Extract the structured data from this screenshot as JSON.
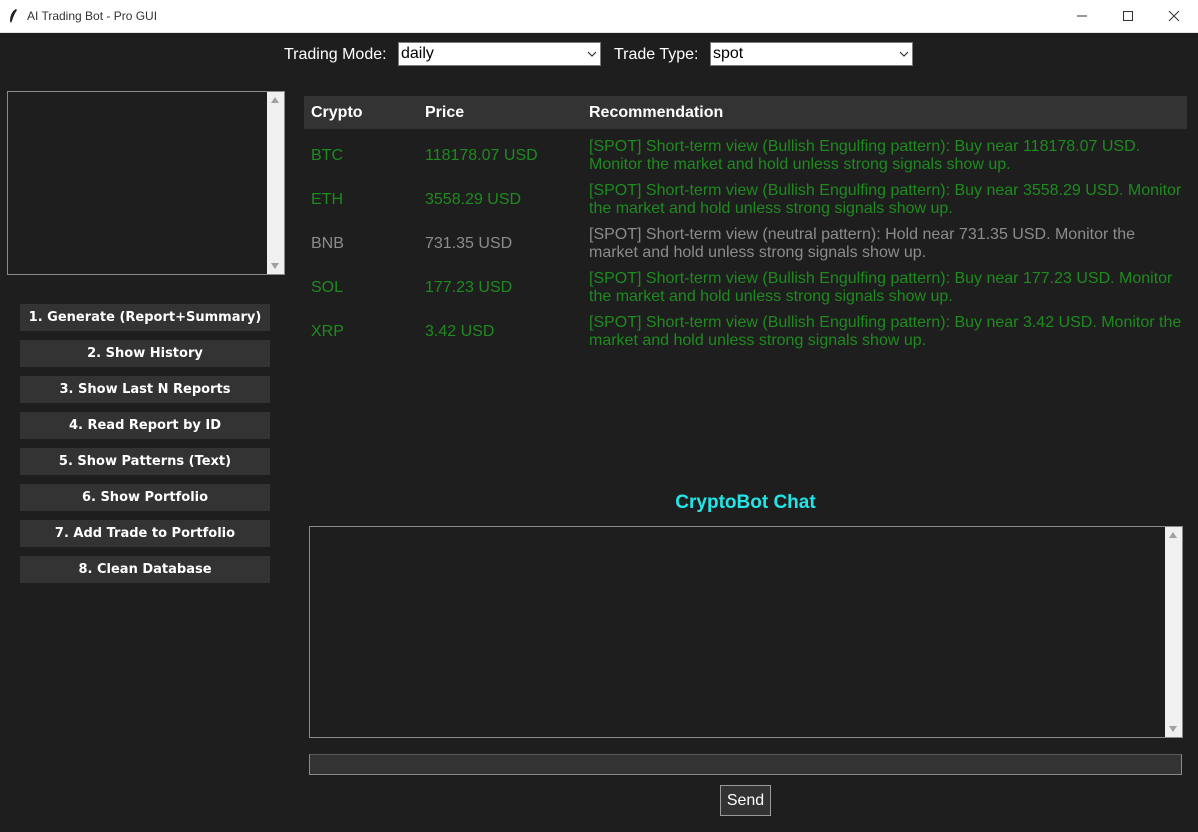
{
  "window": {
    "title": "AI Trading Bot - Pro GUI",
    "controls": [
      "minimize-icon",
      "maximize-icon",
      "close-icon"
    ]
  },
  "controls": {
    "mode_label": "Trading Mode:",
    "mode_value": "daily",
    "type_label": "Trade Type:",
    "type_value": "spot"
  },
  "sidebar": {
    "buttons": [
      "1. Generate (Report+Summary)",
      "2. Show History",
      "3. Show Last N Reports",
      "4. Read Report by ID",
      "5. Show Patterns (Text)",
      "6. Show Portfolio",
      "7. Add Trade to Portfolio",
      "8. Clean Database"
    ]
  },
  "table": {
    "headers": [
      "Crypto",
      "Price",
      "Recommendation"
    ],
    "rows": [
      {
        "crypto": "BTC",
        "price": "118178.07 USD",
        "recommendation": "[SPOT] Short-term view (Bullish Engulfing pattern): Buy near 118178.07 USD. Monitor the market and hold unless strong signals show up.",
        "color": "#1f8a1f"
      },
      {
        "crypto": "ETH",
        "price": "3558.29 USD",
        "recommendation": "[SPOT] Short-term view (Bullish Engulfing pattern): Buy near 3558.29 USD. Monitor the market and hold unless strong signals show up.",
        "color": "#1f8a1f"
      },
      {
        "crypto": "BNB",
        "price": "731.35 USD",
        "recommendation": "[SPOT] Short-term view (neutral pattern): Hold near 731.35 USD. Monitor the market and hold unless strong signals show up.",
        "color": "#8c8c8c"
      },
      {
        "crypto": "SOL",
        "price": "177.23 USD",
        "recommendation": "[SPOT] Short-term view (Bullish Engulfing pattern): Buy near 177.23 USD. Monitor the market and hold unless strong signals show up.",
        "color": "#1f8a1f"
      },
      {
        "crypto": "XRP",
        "price": "3.42 USD",
        "recommendation": "[SPOT] Short-term view (Bullish Engulfing pattern): Buy near 3.42 USD. Monitor the market and hold unless strong signals show up.",
        "color": "#1f8a1f"
      }
    ]
  },
  "chat": {
    "title": "CryptoBot Chat",
    "title_color": "#22e5e5",
    "send_label": "Send"
  },
  "colors": {
    "background": "#1e1e1e",
    "button": "#333333",
    "buy": "#1f8a1f",
    "hold": "#8c8c8c"
  }
}
